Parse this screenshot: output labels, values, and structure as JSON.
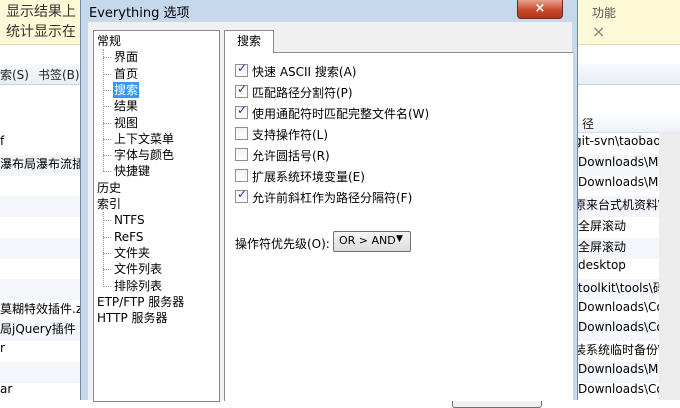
{
  "background": {
    "banner": [
      "显示结果上",
      "统计显示在"
    ],
    "banner_right": "功能",
    "banner_close": "×",
    "menu": [
      "索(S)",
      "书签(B)"
    ],
    "column_path": "径",
    "rows": [
      {
        "left": "f",
        "right": "git-svn\\taobaoco"
      },
      {
        "left": "瀑布局瀑布流插件",
        "right": "\\Downloads\\Mus"
      },
      {
        "left": "",
        "right": "\\Downloads\\Mus"
      },
      {
        "left": "",
        "right": "原来台式机资料\\百"
      },
      {
        "left": "",
        "right": "\\全屏滚动"
      },
      {
        "left": "",
        "right": "\\全屏滚动"
      },
      {
        "left": "",
        "right": "\\desktop"
      },
      {
        "left": "",
        "right": "\\toolkit\\tools\\码农"
      },
      {
        "left": "莫糊特效插件.zi",
        "right": "\\Downloads\\Com"
      },
      {
        "left": "局jQuery插件",
        "right": "\\Downloads\\Com"
      },
      {
        "left": "r",
        "right": "装系统临时备份\\"
      },
      {
        "left": "",
        "right": "\\Downloads\\Mus"
      },
      {
        "left": "ar",
        "right": "\\Downloads\\Com"
      }
    ]
  },
  "dialog": {
    "title": "Everything 选项",
    "close_label": "×",
    "tree": [
      {
        "label": "常规",
        "level": 0
      },
      {
        "label": "界面",
        "level": 1
      },
      {
        "label": "首页",
        "level": 1
      },
      {
        "label": "搜索",
        "level": 1,
        "selected": true
      },
      {
        "label": "结果",
        "level": 1
      },
      {
        "label": "视图",
        "level": 1
      },
      {
        "label": "上下文菜单",
        "level": 1
      },
      {
        "label": "字体与颜色",
        "level": 1
      },
      {
        "label": "快捷键",
        "level": 1
      },
      {
        "label": "历史",
        "level": 0
      },
      {
        "label": "索引",
        "level": 0
      },
      {
        "label": "NTFS",
        "level": 1
      },
      {
        "label": "ReFS",
        "level": 1
      },
      {
        "label": "文件夹",
        "level": 1
      },
      {
        "label": "文件列表",
        "level": 1
      },
      {
        "label": "排除列表",
        "level": 1
      },
      {
        "label": "ETP/FTP 服务器",
        "level": 0
      },
      {
        "label": "HTTP 服务器",
        "level": 0
      }
    ],
    "tab_label": "搜索",
    "options": [
      {
        "label": "快速 ASCII 搜索(A)",
        "checked": true
      },
      {
        "label": "匹配路径分割符(P)",
        "checked": true
      },
      {
        "label": "使用通配符时匹配完整文件名(W)",
        "checked": true
      },
      {
        "label": "支持操作符(L)",
        "checked": false
      },
      {
        "label": "允许圆括号(R)",
        "checked": false
      },
      {
        "label": "扩展系统环境变量(E)",
        "checked": false
      },
      {
        "label": "允许前斜杠作为路径分隔符(F)",
        "checked": true
      }
    ],
    "priority_label": "操作符优先级(O):",
    "priority_value": "OR > AND",
    "checkmark": "✓",
    "dropdown_arrow": "▼"
  }
}
